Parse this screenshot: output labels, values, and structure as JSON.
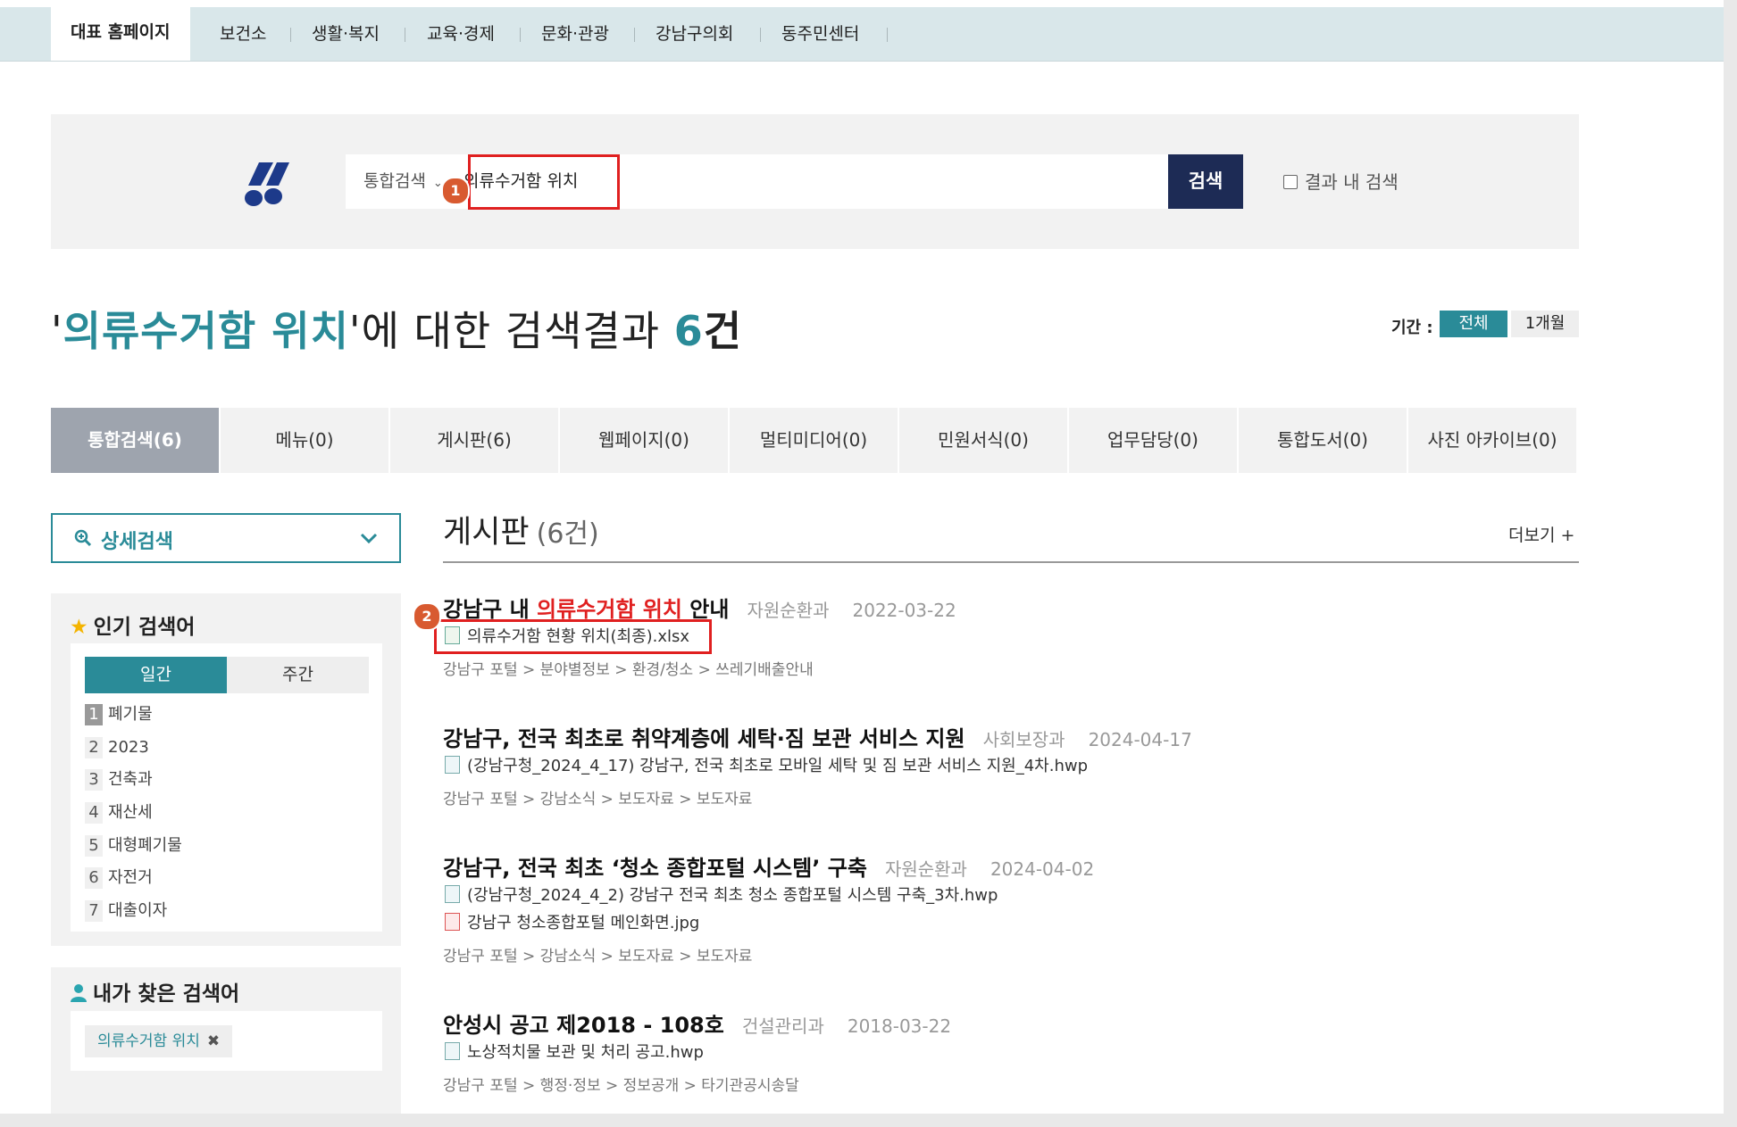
{
  "topnav": {
    "tabs": [
      "대표 홈페이지",
      "보건소",
      "생활·복지",
      "교육·경제",
      "문화·관광",
      "강남구의회",
      "동주민센터"
    ]
  },
  "search": {
    "scope_label": "통합검색",
    "query": "의류수거함 위치",
    "button_label": "검색",
    "within_results_label": "결과 내 검색",
    "annotation_1": "1"
  },
  "results_header": {
    "quote_open": "'",
    "query": "의류수거함 위치",
    "suffix": "'에 대한 검색결과 ",
    "count": "6",
    "unit": "건"
  },
  "period": {
    "label": "기간 :",
    "options": [
      "전체",
      "1개월"
    ],
    "selected": "전체"
  },
  "category_tabs": [
    "통합검색(6)",
    "메뉴(0)",
    "게시판(6)",
    "웹페이지(0)",
    "멀티미디어(0)",
    "민원서식(0)",
    "업무담당(0)",
    "통합도서(0)",
    "사진 아카이브(0)"
  ],
  "sidebar": {
    "advanced_search_label": "상세검색",
    "popular_title": "인기 검색어",
    "popular_tabs": [
      "일간",
      "주간"
    ],
    "popular_keywords": [
      {
        "rank": "1",
        "text": "폐기물"
      },
      {
        "rank": "2",
        "text": "2023"
      },
      {
        "rank": "3",
        "text": "건축과"
      },
      {
        "rank": "4",
        "text": "재산세"
      },
      {
        "rank": "5",
        "text": "대형폐기물"
      },
      {
        "rank": "6",
        "text": "자전거"
      },
      {
        "rank": "7",
        "text": "대출이자"
      }
    ],
    "my_searches_title": "내가 찾은 검색어",
    "my_searches": [
      "의류수거함 위치"
    ]
  },
  "board": {
    "heading": "게시판",
    "count": "(6건)",
    "more_label": "더보기 +",
    "annotation_2": "2",
    "items": [
      {
        "title_pre": "강남구 내 ",
        "title_hl": "의류수거함 위치",
        "title_post": " 안내",
        "dept": "자원순환과",
        "date": "2022-03-22",
        "attachments": [
          "의류수거함 현황 위치(최종).xlsx"
        ],
        "breadcrumb": "강남구 포털 > 분야별정보 > 환경/청소 > 쓰레기배출안내"
      },
      {
        "title": "강남구, 전국 최초로 취약계층에 세탁·짐 보관 서비스 지원",
        "dept": "사회보장과",
        "date": "2024-04-17",
        "attachments": [
          "(강남구청_2024_4_17) 강남구, 전국 최초로 모바일 세탁 및 짐 보관 서비스 지원_4차.hwp"
        ],
        "breadcrumb": "강남구 포털 > 강남소식 > 보도자료 > 보도자료"
      },
      {
        "title": "강남구, 전국 최초 ‘청소 종합포털 시스템’ 구축",
        "dept": "자원순환과",
        "date": "2024-04-02",
        "attachments": [
          "(강남구청_2024_4_2) 강남구 전국 최초 청소 종합포털 시스템 구축_3차.hwp",
          "강남구 청소종합포털 메인화면.jpg"
        ],
        "breadcrumb": "강남구 포털 > 강남소식 > 보도자료 > 보도자료"
      },
      {
        "title": "안성시 공고 제2018 - 108호",
        "dept": "건설관리과",
        "date": "2018-03-22",
        "attachments": [
          "노상적치물 보관 및 처리 공고.hwp"
        ],
        "breadcrumb": "강남구 포털 > 행정·정보 > 정보공개 > 타기관공시송달"
      }
    ]
  },
  "colors": {
    "accent": "#2a8b98",
    "navy": "#1d2b55",
    "highlight_red": "#e02020",
    "topbar_bg": "#d9e7ea"
  }
}
